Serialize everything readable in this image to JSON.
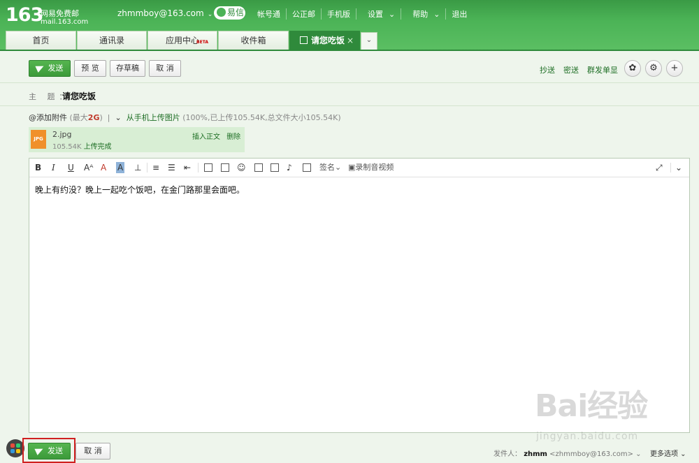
{
  "header": {
    "logo_number": "163",
    "logo_name": "网易免费邮",
    "logo_domain": "mail.163.com",
    "user_email": "zhmmboy@163.com",
    "yixin_label": "易信",
    "links": [
      "帐号通",
      "公正邮",
      "手机版",
      "设置",
      "帮助",
      "退出"
    ]
  },
  "tabs": [
    {
      "label": "首页"
    },
    {
      "label": "通讯录"
    },
    {
      "label": "应用中心",
      "badge": "BETA"
    },
    {
      "label": "收件箱"
    },
    {
      "label": "请您吃饭",
      "active": true
    }
  ],
  "toolbar": {
    "send_label": "发送",
    "preview_label": "预 览",
    "draft_label": "存草稿",
    "cancel_label": "取 消",
    "cc_label": "抄送",
    "bcc_label": "密送",
    "group_label": "群发单显"
  },
  "compose": {
    "subject_label": "主 题：",
    "subject_value": "请您吃饭",
    "attach_label": "添加附件",
    "attach_max_prefix": "(最大",
    "attach_max": "2G",
    "attach_max_suffix": ")",
    "phone_upload_label": "从手机上传图片",
    "upload_status": "(100%,已上传105.54K,总文件大小105.54K)",
    "file": {
      "type": "JPG",
      "name": "2.jpg",
      "size": "105.54K",
      "status": "上传完成",
      "insert_label": "插入正文",
      "delete_label": "删除"
    },
    "signature_label": "签名",
    "record_label": "录制音视频",
    "body_text": "晚上有约没？晚上一起吃个饭吧，在金门路那里会面吧。"
  },
  "bottom": {
    "send_label": "发送",
    "cancel_label": "取 消",
    "sender_label": "发件人：",
    "sender_name": "zhmm",
    "sender_email": "<zhmmboy@163.com>",
    "more_options": "更多选项"
  },
  "watermark": {
    "brand": "Bai经验",
    "url": "jingyan.baidu.com"
  },
  "colors": {
    "brand_green": "#3c9a3a",
    "header_green": "#4bb356",
    "highlight_red": "#d02020"
  }
}
